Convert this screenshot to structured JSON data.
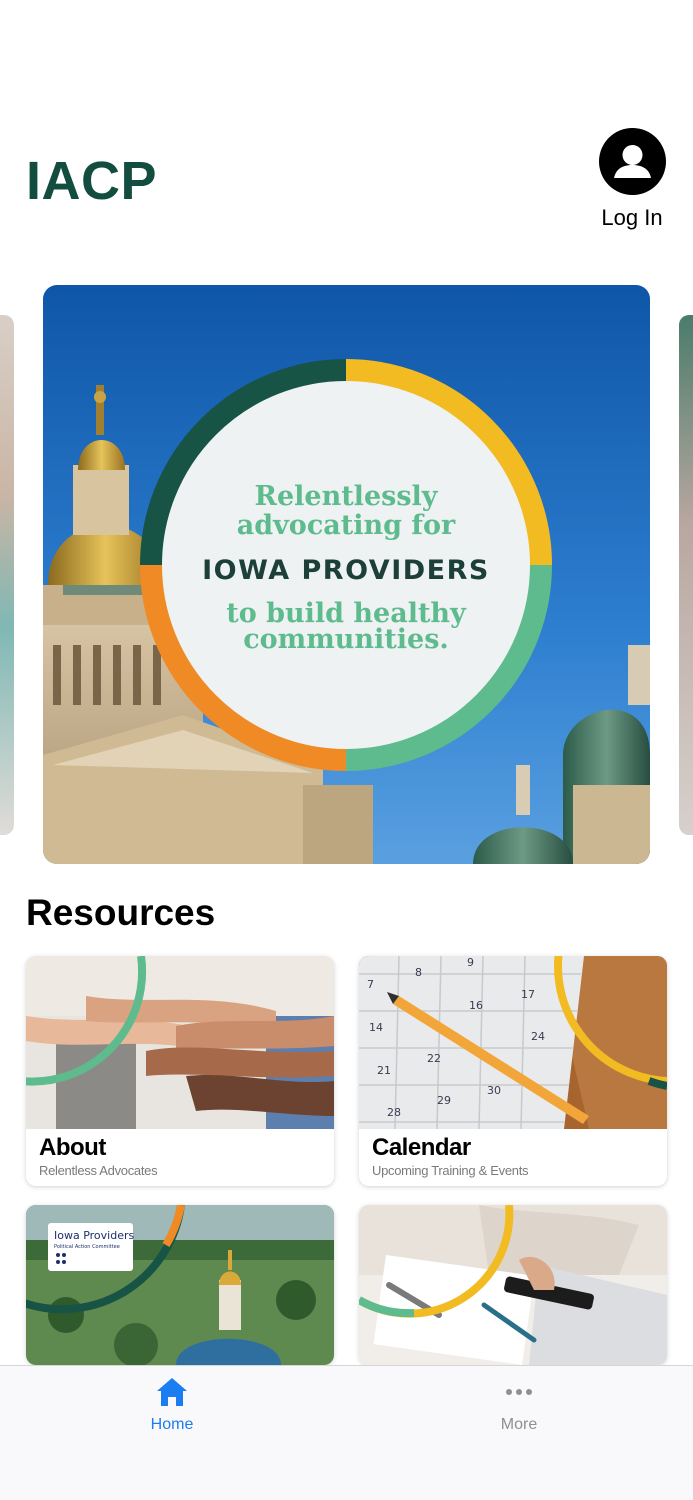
{
  "header": {
    "app_title": "IACP",
    "login_label": "Log In",
    "login_icon": "person-circle-icon"
  },
  "hero": {
    "line1": "Relentlessly",
    "line2": "advocating for",
    "line3": "IOWA PROVIDERS",
    "line4": "to build healthy",
    "line5": "communities."
  },
  "resources": {
    "title": "Resources",
    "tiles": [
      {
        "title": "About",
        "subtitle": "Relentless Advocates"
      },
      {
        "title": "Calendar",
        "subtitle": "Upcoming Training & Events"
      },
      {
        "inset_title": "Iowa Providers",
        "inset_subtitle": "Political Action Committee"
      },
      {}
    ],
    "calendar_numbers": [
      "7",
      "8",
      "9",
      "16",
      "17",
      "14",
      "24",
      "21",
      "22",
      "28",
      "29",
      "30"
    ]
  },
  "tabbar": {
    "items": [
      {
        "label": "Home",
        "icon": "house-icon",
        "active": true
      },
      {
        "label": "More",
        "icon": "ellipsis-icon",
        "active": false
      }
    ],
    "active_color": "#1a7ef2",
    "inactive_color": "#8e8e93"
  },
  "colors": {
    "brand_green": "#124d3f",
    "ring_yellow": "#f2bb22",
    "ring_mint": "#5dbb8d",
    "ring_orange": "#f08a24",
    "ring_dark": "#175445"
  }
}
